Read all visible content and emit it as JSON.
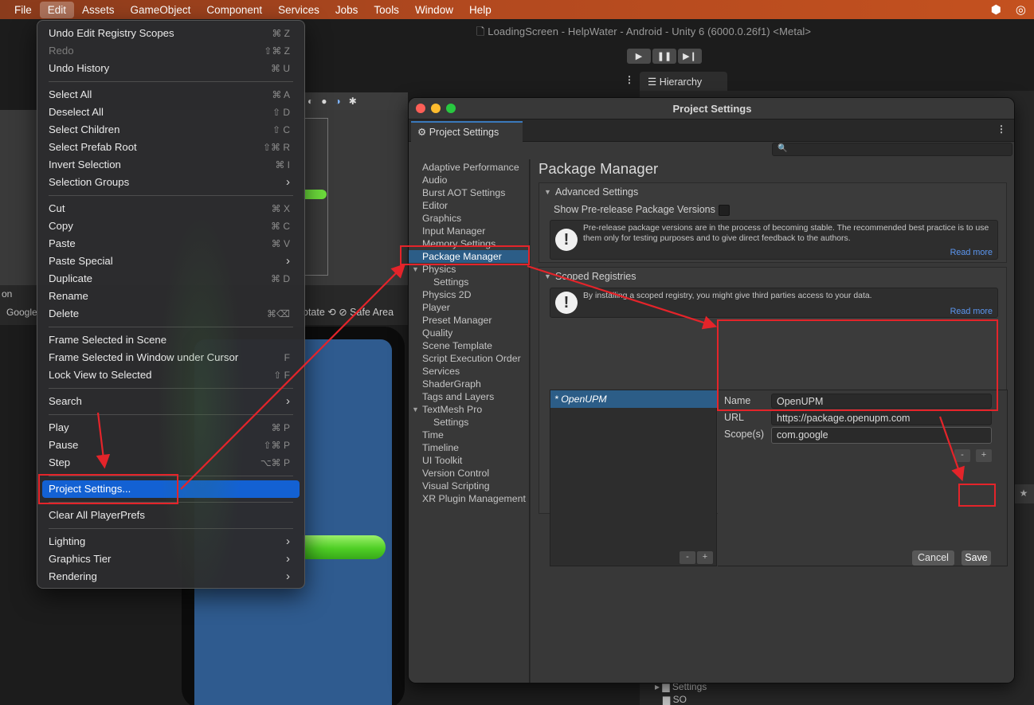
{
  "menubar": {
    "items": [
      "File",
      "Edit",
      "Assets",
      "GameObject",
      "Component",
      "Services",
      "Jobs",
      "Tools",
      "Window",
      "Help"
    ],
    "active": "Edit"
  },
  "editor": {
    "window_title": "LoadingScreen - HelpWater - Android - Unity 6 (6000.0.26f1) <Metal>",
    "hierarchy_tab": "Hierarchy",
    "game_toolbar_text": "otate  ⟲  ⊘  Safe Area",
    "left_labels": [
      "on",
      "Google"
    ],
    "project_tree": [
      "Settings",
      "SO"
    ]
  },
  "edit_menu": {
    "groups": [
      [
        {
          "label": "Undo Edit Registry Scopes",
          "shortcut": "⌘ Z"
        },
        {
          "label": "Redo",
          "shortcut": "⇧⌘ Z",
          "disabled": true
        },
        {
          "label": "Undo History",
          "shortcut": "⌘ U"
        }
      ],
      [
        {
          "label": "Select All",
          "shortcut": "⌘ A"
        },
        {
          "label": "Deselect All",
          "shortcut": "⇧ D"
        },
        {
          "label": "Select Children",
          "shortcut": "⇧ C"
        },
        {
          "label": "Select Prefab Root",
          "shortcut": "⇧⌘ R"
        },
        {
          "label": "Invert Selection",
          "shortcut": "⌘ I"
        },
        {
          "label": "Selection Groups",
          "submenu": true
        }
      ],
      [
        {
          "label": "Cut",
          "shortcut": "⌘ X"
        },
        {
          "label": "Copy",
          "shortcut": "⌘ C"
        },
        {
          "label": "Paste",
          "shortcut": "⌘ V"
        },
        {
          "label": "Paste Special",
          "submenu": true
        },
        {
          "label": "Duplicate",
          "shortcut": "⌘ D"
        },
        {
          "label": "Rename",
          "shortcut": ""
        },
        {
          "label": "Delete",
          "shortcut": "⌘⌫"
        }
      ],
      [
        {
          "label": "Frame Selected in Scene",
          "shortcut": ""
        },
        {
          "label": "Frame Selected in Window under Cursor",
          "shortcut": "F"
        },
        {
          "label": "Lock View to Selected",
          "shortcut": "⇧ F"
        }
      ],
      [
        {
          "label": "Search",
          "submenu": true
        }
      ],
      [
        {
          "label": "Play",
          "shortcut": "⌘ P"
        },
        {
          "label": "Pause",
          "shortcut": "⇧⌘ P"
        },
        {
          "label": "Step",
          "shortcut": "⌥⌘ P"
        }
      ],
      [
        {
          "label": "Project Settings...",
          "shortcut": "",
          "highlight": true
        }
      ],
      [
        {
          "label": "Clear All PlayerPrefs",
          "shortcut": ""
        }
      ],
      [
        {
          "label": "Lighting",
          "submenu": true
        },
        {
          "label": "Graphics Tier",
          "submenu": true
        },
        {
          "label": "Rendering",
          "submenu": true
        }
      ]
    ]
  },
  "project_settings": {
    "title": "Project Settings",
    "tab_label": "Project Settings",
    "sidebar": [
      {
        "label": "Adaptive Performance"
      },
      {
        "label": "Audio"
      },
      {
        "label": "Burst AOT Settings"
      },
      {
        "label": "Editor"
      },
      {
        "label": "Graphics"
      },
      {
        "label": "Input Manager"
      },
      {
        "label": "Memory Settings"
      },
      {
        "label": "Package Manager",
        "selected": true
      },
      {
        "label": "Physics",
        "arrow": true
      },
      {
        "label": "Settings",
        "sub": true
      },
      {
        "label": "Physics 2D"
      },
      {
        "label": "Player"
      },
      {
        "label": "Preset Manager"
      },
      {
        "label": "Quality"
      },
      {
        "label": "Scene Template"
      },
      {
        "label": "Script Execution Order"
      },
      {
        "label": "Services"
      },
      {
        "label": "ShaderGraph"
      },
      {
        "label": "Tags and Layers"
      },
      {
        "label": "TextMesh Pro",
        "arrow": true
      },
      {
        "label": "Settings",
        "sub": true
      },
      {
        "label": "Time"
      },
      {
        "label": "Timeline"
      },
      {
        "label": "UI Toolkit"
      },
      {
        "label": "Version Control"
      },
      {
        "label": "Visual Scripting"
      },
      {
        "label": "XR Plugin Management"
      }
    ],
    "page_title": "Package Manager",
    "advanced": {
      "header": "Advanced Settings",
      "prerelease_label": "Show Pre-release Package Versions",
      "help": "Pre-release package versions are in the process of becoming stable. The recommended best practice is to use them only for testing purposes and to give direct feedback to the authors.",
      "read_more": "Read more"
    },
    "scoped": {
      "header": "Scoped Registries",
      "help": "By installing a scoped registry, you might give third parties access to your data.",
      "read_more": "Read more",
      "registries": [
        "* OpenUPM"
      ],
      "name_label": "Name",
      "name_value": "OpenUPM",
      "url_label": "URL",
      "url_value": "https://package.openupm.com",
      "scopes_label": "Scope(s)",
      "scopes_value": "com.google",
      "minus": "-",
      "plus": "+",
      "cancel": "Cancel",
      "save": "Save"
    }
  },
  "colors": {
    "menubar_gradient": [
      "#8a3b1c",
      "#c4511f"
    ],
    "menu_highlight": "#1361d3",
    "selection": "#2c5d87",
    "annotation_red": "#e4242a",
    "link": "#5b96f0"
  }
}
